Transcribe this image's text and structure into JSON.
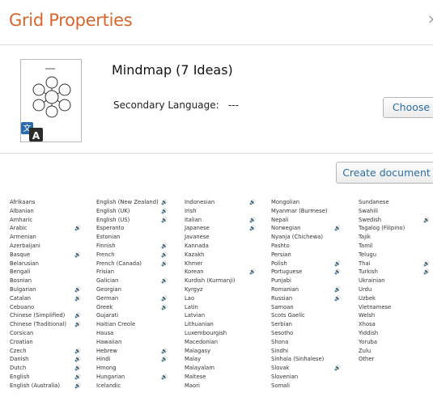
{
  "dialog": {
    "title": "Grid Properties",
    "close_glyph": "×"
  },
  "document": {
    "name": "Mindmap (7 Ideas)",
    "secondary_language_label": "Secondary Language:",
    "secondary_language_value": "---",
    "choose_label": "Choose",
    "create_label": "Create document",
    "thumbnail_icon": "mindmap-icon",
    "badge_icon": "translate-icon"
  },
  "speaker_glyph": "🔊",
  "languages": [
    [
      {
        "name": "Afrikaans",
        "tts": false
      },
      {
        "name": "Albanian",
        "tts": false
      },
      {
        "name": "Amharic",
        "tts": false
      },
      {
        "name": "Arabic",
        "tts": true
      },
      {
        "name": "Armenian",
        "tts": false
      },
      {
        "name": "Azerbaijani",
        "tts": false
      },
      {
        "name": "Basque",
        "tts": true
      },
      {
        "name": "Belarusian",
        "tts": false
      },
      {
        "name": "Bengali",
        "tts": false
      },
      {
        "name": "Bosnian",
        "tts": false
      },
      {
        "name": "Bulgarian",
        "tts": true
      },
      {
        "name": "Catalan",
        "tts": true
      },
      {
        "name": "Cebuano",
        "tts": false
      },
      {
        "name": "Chinese (Simplified)",
        "tts": true
      },
      {
        "name": "Chinese (Traditional)",
        "tts": true
      },
      {
        "name": "Corsican",
        "tts": false
      },
      {
        "name": "Croatian",
        "tts": false
      },
      {
        "name": "Czech",
        "tts": true
      },
      {
        "name": "Danish",
        "tts": true
      },
      {
        "name": "Dutch",
        "tts": true
      },
      {
        "name": "English",
        "tts": true
      },
      {
        "name": "English (Australia)",
        "tts": true
      }
    ],
    [
      {
        "name": "English (New Zealand)",
        "tts": true
      },
      {
        "name": "English (UK)",
        "tts": true
      },
      {
        "name": "English (US)",
        "tts": true
      },
      {
        "name": "Esperanto",
        "tts": false
      },
      {
        "name": "Estonian",
        "tts": false
      },
      {
        "name": "Finnish",
        "tts": true
      },
      {
        "name": "French",
        "tts": true
      },
      {
        "name": "French (Canada)",
        "tts": true
      },
      {
        "name": "Frisian",
        "tts": false
      },
      {
        "name": "Galician",
        "tts": true
      },
      {
        "name": "Georgian",
        "tts": false
      },
      {
        "name": "German",
        "tts": true
      },
      {
        "name": "Greek",
        "tts": true
      },
      {
        "name": "Gujarati",
        "tts": false
      },
      {
        "name": "Haitian Creole",
        "tts": false
      },
      {
        "name": "Hausa",
        "tts": false
      },
      {
        "name": "Hawaiian",
        "tts": false
      },
      {
        "name": "Hebrew",
        "tts": true
      },
      {
        "name": "Hindi",
        "tts": true
      },
      {
        "name": "Hmong",
        "tts": false
      },
      {
        "name": "Hungarian",
        "tts": true
      },
      {
        "name": "Icelandic",
        "tts": false
      }
    ],
    [
      {
        "name": "Indonesian",
        "tts": true
      },
      {
        "name": "Irish",
        "tts": false
      },
      {
        "name": "Italian",
        "tts": true
      },
      {
        "name": "Japanese",
        "tts": true
      },
      {
        "name": "Javanese",
        "tts": false
      },
      {
        "name": "Kannada",
        "tts": false
      },
      {
        "name": "Kazakh",
        "tts": false
      },
      {
        "name": "Khmer",
        "tts": false
      },
      {
        "name": "Korean",
        "tts": true
      },
      {
        "name": "Kurdish (Kurmanji)",
        "tts": false
      },
      {
        "name": "Kyrgyz",
        "tts": false
      },
      {
        "name": "Lao",
        "tts": false
      },
      {
        "name": "Latin",
        "tts": false
      },
      {
        "name": "Latvian",
        "tts": false
      },
      {
        "name": "Lithuanian",
        "tts": false
      },
      {
        "name": "Luxembourgish",
        "tts": false
      },
      {
        "name": "Macedonian",
        "tts": false
      },
      {
        "name": "Malagasy",
        "tts": false
      },
      {
        "name": "Malay",
        "tts": false
      },
      {
        "name": "Malayalam",
        "tts": false
      },
      {
        "name": "Maltese",
        "tts": false
      },
      {
        "name": "Maori",
        "tts": false
      }
    ],
    [
      {
        "name": "Mongolian",
        "tts": false
      },
      {
        "name": "Myanmar (Burmese)",
        "tts": false
      },
      {
        "name": "Nepali",
        "tts": false
      },
      {
        "name": "Norwegian",
        "tts": true
      },
      {
        "name": "Nyanja (Chichewa)",
        "tts": false
      },
      {
        "name": "Pashto",
        "tts": false
      },
      {
        "name": "Persian",
        "tts": false
      },
      {
        "name": "Polish",
        "tts": true
      },
      {
        "name": "Portuguese",
        "tts": true
      },
      {
        "name": "Punjabi",
        "tts": false
      },
      {
        "name": "Romanian",
        "tts": true
      },
      {
        "name": "Russian",
        "tts": true
      },
      {
        "name": "Samoan",
        "tts": false
      },
      {
        "name": "Scots Gaelic",
        "tts": false
      },
      {
        "name": "Serbian",
        "tts": false
      },
      {
        "name": "Sesotho",
        "tts": false
      },
      {
        "name": "Shona",
        "tts": false
      },
      {
        "name": "Sindhi",
        "tts": false
      },
      {
        "name": "Sinhala (Sinhalese)",
        "tts": false
      },
      {
        "name": "Slovak",
        "tts": true
      },
      {
        "name": "Slovenian",
        "tts": false
      },
      {
        "name": "Somali",
        "tts": false
      }
    ],
    [
      {
        "name": "Sundanese",
        "tts": false
      },
      {
        "name": "Swahili",
        "tts": false
      },
      {
        "name": "Swedish",
        "tts": true
      },
      {
        "name": "Tagalog (Filipino)",
        "tts": false
      },
      {
        "name": "Tajik",
        "tts": false
      },
      {
        "name": "Tamil",
        "tts": false
      },
      {
        "name": "Telugu",
        "tts": false
      },
      {
        "name": "Thai",
        "tts": true
      },
      {
        "name": "Turkish",
        "tts": true
      },
      {
        "name": "Ukrainian",
        "tts": false
      },
      {
        "name": "Urdu",
        "tts": false
      },
      {
        "name": "Uzbek",
        "tts": false
      },
      {
        "name": "Vietnamese",
        "tts": false
      },
      {
        "name": "Welsh",
        "tts": false
      },
      {
        "name": "Xhosa",
        "tts": false
      },
      {
        "name": "Yiddish",
        "tts": false
      },
      {
        "name": "Yoruba",
        "tts": false
      },
      {
        "name": "Zulu",
        "tts": false
      },
      {
        "name": "Other",
        "tts": false
      }
    ]
  ]
}
